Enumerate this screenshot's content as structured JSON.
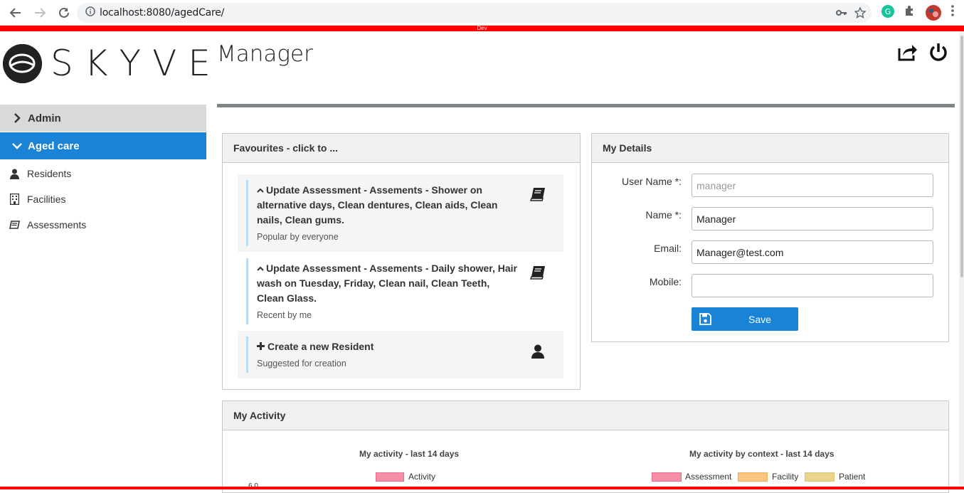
{
  "browser": {
    "url": "localhost:8080/agedCare/"
  },
  "dev_label": "Dev",
  "app": {
    "logo_text": "SKYVE",
    "page_title": "Manager"
  },
  "sidebar": {
    "groups": [
      {
        "label": "Admin",
        "expanded": false
      },
      {
        "label": "Aged care",
        "expanded": true
      }
    ],
    "items": [
      {
        "label": "Residents",
        "icon": "user-icon"
      },
      {
        "label": "Facilities",
        "icon": "building-icon"
      },
      {
        "label": "Assessments",
        "icon": "book-icon"
      }
    ]
  },
  "favourites": {
    "title": "Favourites - click to ...",
    "items": [
      {
        "prefix": "^",
        "title_lines": [
          "Update Assessment - Assements - Shower on",
          "alternative days, Clean dentures, Clean aids, Clean",
          "nails, Clean gums."
        ],
        "subtitle": "Popular by everyone",
        "icon": "book-icon"
      },
      {
        "prefix": "^",
        "title_lines": [
          "Update Assessment - Assements - Daily shower, Hair",
          "wash on Tuesday, Friday, Clean nail, Clean Teeth,",
          "Clean Glass."
        ],
        "subtitle": "Recent by me",
        "icon": "book-icon"
      },
      {
        "prefix": "+",
        "title_lines": [
          "Create a new Resident"
        ],
        "subtitle": "Suggested for creation",
        "icon": "user-icon"
      }
    ]
  },
  "details": {
    "title": "My Details",
    "fields": [
      {
        "label": "User Name *:",
        "value": "manager",
        "disabled": true
      },
      {
        "label": "Name *:",
        "value": "Manager",
        "disabled": false
      },
      {
        "label": "Email:",
        "value": "Manager@test.com",
        "disabled": false
      },
      {
        "label": "Mobile:",
        "value": "",
        "disabled": false
      }
    ],
    "save_label": "Save"
  },
  "activity": {
    "title": "My Activity",
    "charts": [
      {
        "title": "My activity - last 14 days",
        "legend": [
          {
            "name": "Activity",
            "color": "#f58fa8"
          }
        ],
        "tick": "6.0"
      },
      {
        "title": "My activity by context - last 14 days",
        "legend": [
          {
            "name": "Assessment",
            "color": "#f58fa8"
          },
          {
            "name": "Facility",
            "color": "#f9c57f"
          },
          {
            "name": "Patient",
            "color": "#e8d48c"
          }
        ]
      }
    ]
  },
  "colors": {
    "accent": "#1a83d6",
    "dev_strip": "#ff0000"
  }
}
